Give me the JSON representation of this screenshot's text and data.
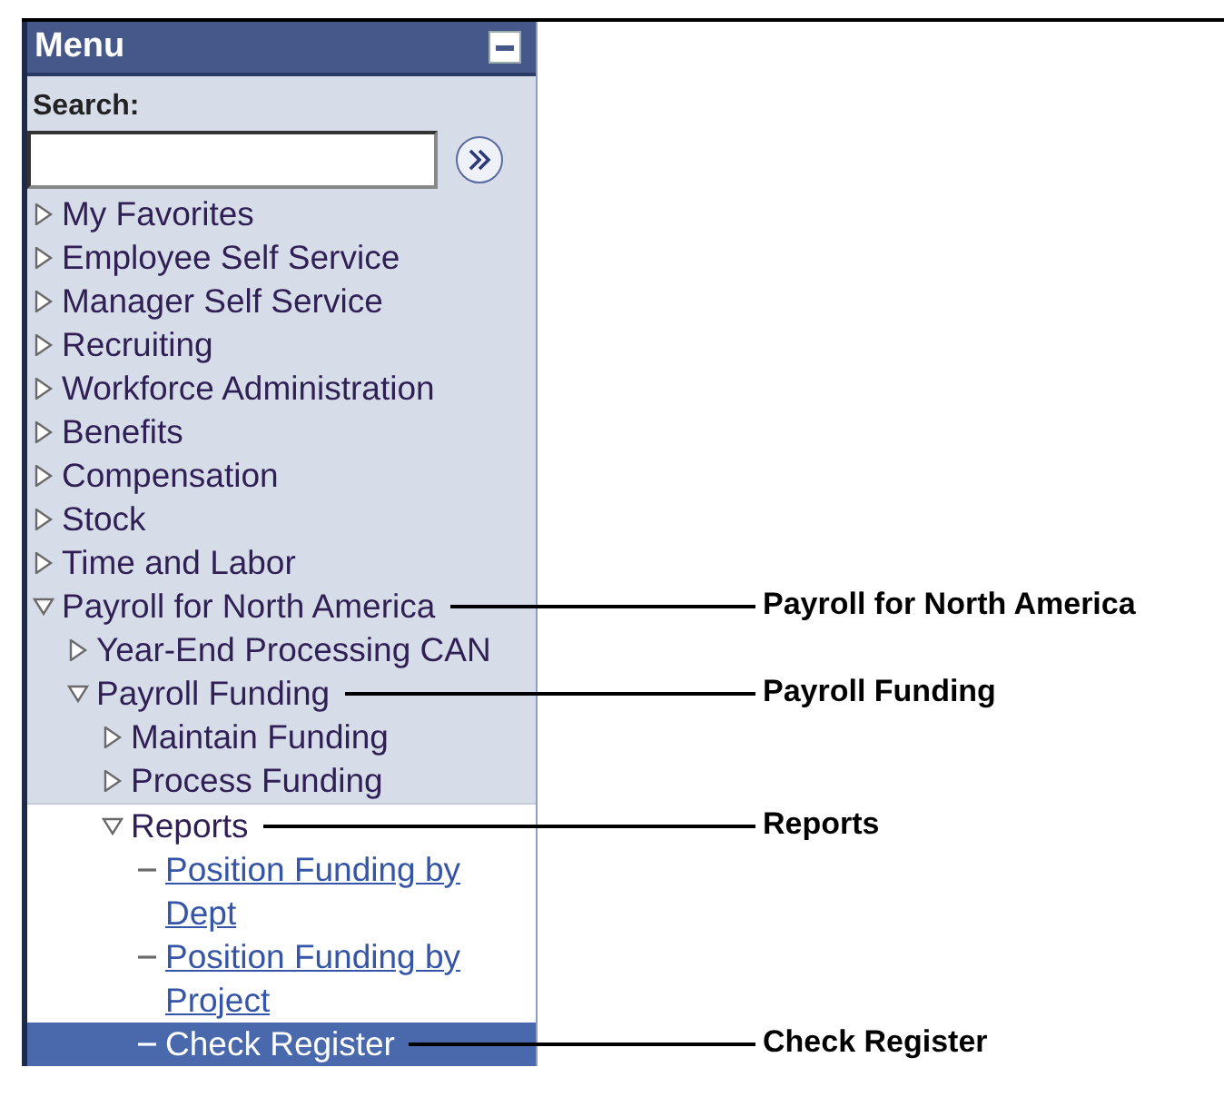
{
  "menu": {
    "title": "Menu",
    "search": {
      "label": "Search:"
    },
    "items": [
      {
        "kind": "folder",
        "label": "My Favorites",
        "expanded": false,
        "selected": false
      },
      {
        "kind": "folder",
        "label": "Employee Self Service",
        "expanded": false,
        "selected": false
      },
      {
        "kind": "folder",
        "label": "Manager Self Service",
        "expanded": false,
        "selected": false
      },
      {
        "kind": "folder",
        "label": "Recruiting",
        "expanded": false,
        "selected": false
      },
      {
        "kind": "folder",
        "label": "Workforce Administration",
        "expanded": false,
        "selected": false
      },
      {
        "kind": "folder",
        "label": "Benefits",
        "expanded": false,
        "selected": false
      },
      {
        "kind": "folder",
        "label": "Compensation",
        "expanded": false,
        "selected": false
      },
      {
        "kind": "folder",
        "label": "Stock",
        "expanded": false,
        "selected": false
      },
      {
        "kind": "folder",
        "label": "Time and Labor",
        "expanded": false,
        "selected": false
      },
      {
        "kind": "folder",
        "label": "Payroll for North America",
        "expanded": true,
        "selected": false,
        "callout": "Payroll for North America",
        "children": [
          {
            "kind": "folder",
            "label": "Year-End Processing CAN",
            "expanded": false,
            "selected": false
          },
          {
            "kind": "folder",
            "label": "Payroll Funding",
            "expanded": true,
            "selected": false,
            "callout": "Payroll Funding",
            "children": [
              {
                "kind": "folder",
                "label": "Maintain Funding",
                "expanded": false,
                "selected": false
              },
              {
                "kind": "folder",
                "label": "Process Funding",
                "expanded": false,
                "selected": false
              },
              {
                "kind": "folder",
                "label": "Reports",
                "expanded": true,
                "selected": false,
                "current": true,
                "callout": "Reports",
                "children": [
                  {
                    "kind": "link",
                    "label": "Position Funding by Dept",
                    "selected": false
                  },
                  {
                    "kind": "link",
                    "label": "Position Funding by Project",
                    "selected": false
                  },
                  {
                    "kind": "link",
                    "label": "Check Register",
                    "selected": true,
                    "callout": "Check Register"
                  }
                ]
              }
            ]
          }
        ]
      }
    ]
  }
}
